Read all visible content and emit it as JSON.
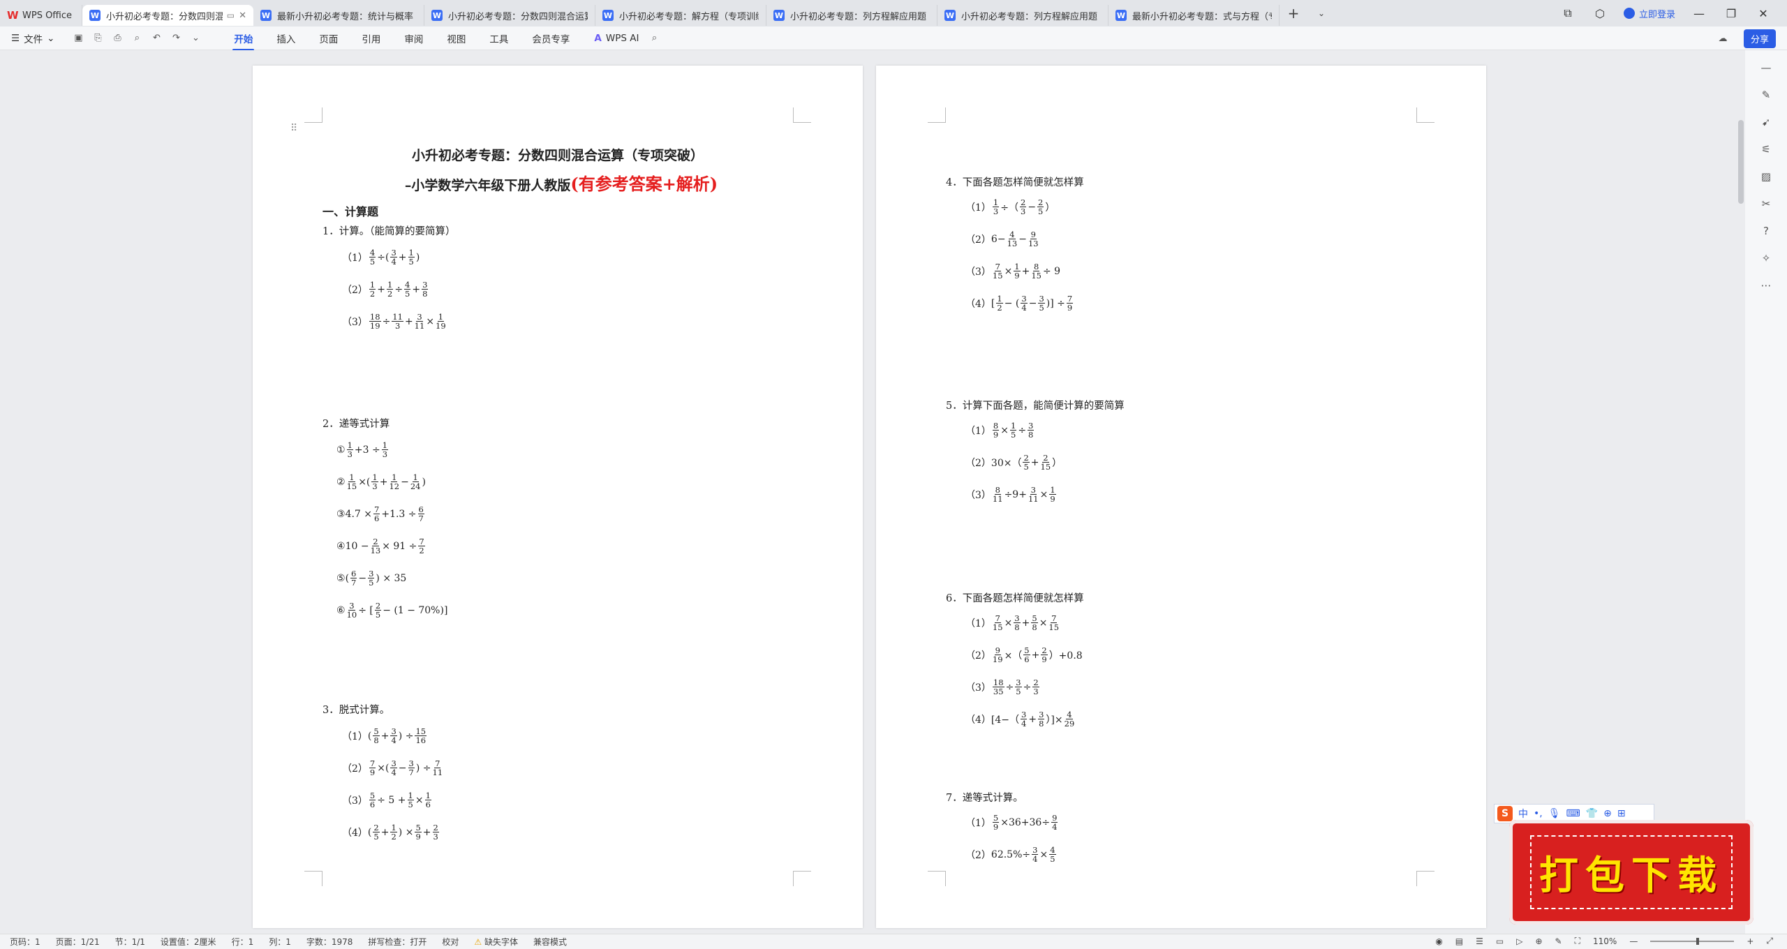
{
  "tabs": [
    {
      "label": "WPS Office",
      "type": "home"
    },
    {
      "label": "小升初必考专题：分数四则混合运算",
      "type": "doc",
      "active": true
    },
    {
      "label": "最新小升初必考专题：统计与概率（",
      "type": "doc"
    },
    {
      "label": "小升初必考专题：分数四则混合运算",
      "type": "doc"
    },
    {
      "label": "小升初必考专题：解方程（专项训练",
      "type": "doc"
    },
    {
      "label": "小升初必考专题：列方程解应用题（",
      "type": "doc"
    },
    {
      "label": "小升初必考专题：列方程解应用题（",
      "type": "doc"
    },
    {
      "label": "最新小升初必考专题：式与方程（专",
      "type": "doc"
    }
  ],
  "titlebar": {
    "login": "立即登录"
  },
  "toolbar": {
    "file": "文件",
    "menus": [
      "开始",
      "插入",
      "页面",
      "引用",
      "审阅",
      "视图",
      "工具",
      "会员专享"
    ],
    "ai": "WPS AI",
    "share": "分享"
  },
  "doc": {
    "title": "小升初必考专题：分数四则混合运算（专项突破）",
    "subtitle_black": "–小学数学六年级下册人教版",
    "subtitle_red": "(有参考答案+解析)",
    "section1": "一、计算题",
    "q1": "1．计算。（能简算的要简算）",
    "q2": "2．递等式计算",
    "q3": "3．脱式计算。",
    "q4": "4．下面各题怎样简便就怎样算",
    "q5": "5．计算下面各题，能简便计算的要简算",
    "q6": "6．下面各题怎样简便就怎样算",
    "q7": "7．递等式计算。",
    "q1_items": [
      "（1）",
      "（2）",
      "（3）"
    ],
    "q2_items": [
      "①",
      "②",
      "③",
      "④",
      "⑤",
      "⑥"
    ],
    "q3_items": [
      "（1）",
      "（2）",
      "（3）",
      "（4）"
    ],
    "q4_items": [
      "（1）",
      "（2）",
      "（3）",
      "（4）"
    ],
    "q5_items": [
      "（1）",
      "（2）",
      "（3）"
    ],
    "q6_items": [
      "（1）",
      "（2）",
      "（3）",
      "（4）"
    ],
    "q7_items": [
      "（1）",
      "（2）"
    ]
  },
  "status": {
    "page_no": "页码：1",
    "pages": "页面：1/21",
    "section": "节：1/1",
    "setting": "设置值：2厘米",
    "row": "行：1",
    "col": "列：1",
    "words": "字数：1978",
    "spell": "拼写检查：打开",
    "proof": "校对",
    "font_missing": "缺失字体",
    "compat": "兼容模式",
    "zoom": "110%"
  },
  "ime": {
    "lang": "中"
  },
  "promo": {
    "text": "打包下载"
  }
}
